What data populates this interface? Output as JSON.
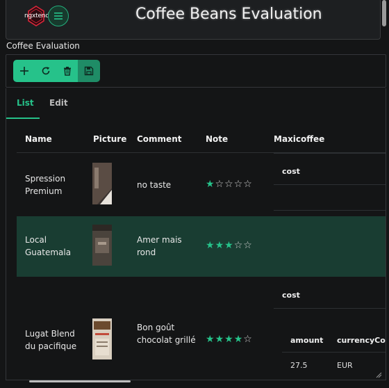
{
  "header": {
    "logo_text": "ngxtend",
    "title": "Coffee Beans Evaluation"
  },
  "panel": {
    "label": "Coffee Evaluation"
  },
  "toolbar": {
    "buttons": [
      "add-icon",
      "refresh-icon",
      "delete-icon",
      "save-icon"
    ]
  },
  "tabs": [
    {
      "label": "List",
      "active": true
    },
    {
      "label": "Edit",
      "active": false
    }
  ],
  "table": {
    "headers": [
      "Name",
      "Picture",
      "Comment",
      "Note",
      "Maxicoffee"
    ],
    "rows": [
      {
        "name": "Spression Premium",
        "comment": "no taste",
        "note": 1,
        "maxicoffee": {
          "label": "cost"
        }
      },
      {
        "name": "Local Guatemala",
        "comment": "Amer mais rond",
        "note": 3,
        "selected": true
      },
      {
        "name": "Lugat Blend du pacifique",
        "comment": "Bon goût chocolat grillé",
        "note": 4,
        "maxicoffee": {
          "label": "cost",
          "columns": [
            "amount",
            "currencyCode"
          ],
          "values": [
            "27.5",
            "EUR"
          ]
        }
      }
    ],
    "max_stars": 5
  },
  "colors": {
    "accent": "#26c28a",
    "selected_row": "#193d32",
    "background": "#141516"
  }
}
